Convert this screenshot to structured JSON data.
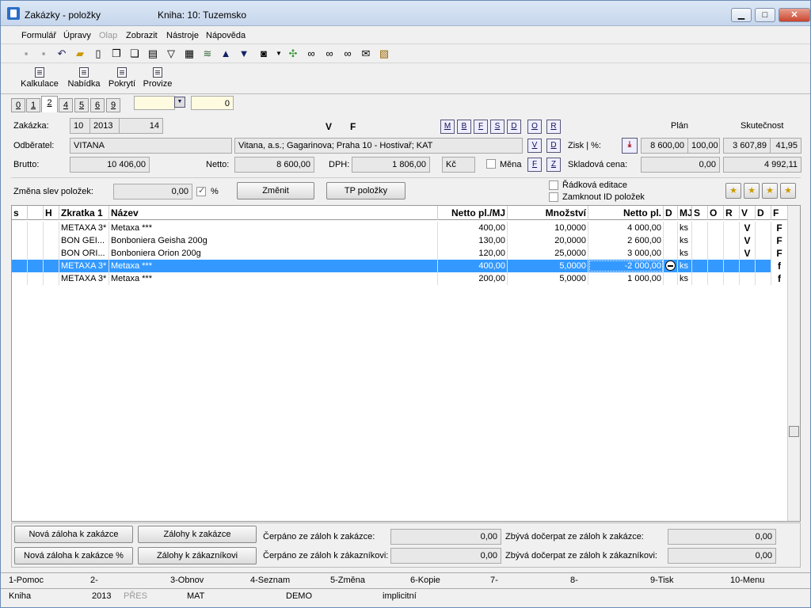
{
  "window": {
    "title": "Zakázky - položky",
    "subtitle": "Kniha: 10: Tuzemsko",
    "btn_min": "▁",
    "btn_max": "□",
    "btn_close": "✕"
  },
  "menu": [
    {
      "label": "Formulář",
      "disabled": false
    },
    {
      "label": "Úpravy",
      "disabled": false
    },
    {
      "label": "Olap",
      "disabled": true
    },
    {
      "label": "Zobrazit",
      "disabled": false
    },
    {
      "label": "Nástroje",
      "disabled": false
    },
    {
      "label": "Nápověda",
      "disabled": false
    }
  ],
  "toolbar_icons": [
    "save-icon",
    "save-as-icon",
    "undo-icon",
    "open-folder-icon",
    "new-doc-icon",
    "copy-icon",
    "paste-icon",
    "book-icon",
    "filter-icon",
    "report-icon",
    "stack-icon",
    "arrow-up-icon",
    "arrow-down-icon",
    "camera-icon",
    "dropdown-icon",
    "plant-icon",
    "binoculars-icon",
    "binoculars-down-icon",
    "binoculars-up-icon",
    "mail-icon",
    "notes-icon"
  ],
  "big_buttons": [
    "Kalkulace",
    "Nabídka",
    "Pokrytí",
    "Provize"
  ],
  "tabs": [
    "0",
    "1",
    "2",
    "4",
    "5",
    "6",
    "9"
  ],
  "tab_active": "2",
  "tab_extra_value": "0",
  "form": {
    "zakazka_label": "Zakázka:",
    "zakazka_book": "10",
    "zakazka_year": "2013",
    "zakazka_num": "14",
    "vf_v": "V",
    "vf_f": "F",
    "mbfsd": [
      "M",
      "B",
      "F",
      "S",
      "D"
    ],
    "ord_btns": [
      "O",
      "R",
      "V",
      "D",
      "F",
      "Z"
    ],
    "odberatel_label": "Odběratel:",
    "odberatel_code": "VITANA",
    "odberatel_full": "Vitana, a.s.; Gagarinova; Praha 10 - Hostivař; KAT",
    "brutto_label": "Brutto:",
    "brutto": "10 406,00",
    "netto_label": "Netto:",
    "netto": "8 600,00",
    "dph_label": "DPH:",
    "dph": "1 806,00",
    "mena_val": "Kč",
    "mena_label": "Měna",
    "plan_label": "Plán",
    "skutecnost_label": "Skutečnost",
    "zisk_label": "Zisk | %:",
    "zisk_plan": "8 600,00",
    "zisk_plan_pct": "100,00",
    "zisk_skut": "3 607,89",
    "zisk_skut_pct": "41,95",
    "skladova_label": "Skladová cena:",
    "skladova_plan": "0,00",
    "skladova_skut": "4 992,11",
    "zmena_label": "Změna slev položek:",
    "zmena_val": "0,00",
    "zmena_pct": "%",
    "zmenit_btn": "Změnit",
    "tp_btn": "TP položky",
    "radkova_label": "Řádková editace",
    "zamknout_label": "Zamknout ID položek"
  },
  "grid": {
    "columns": [
      "s",
      "",
      "H",
      "Zkratka 1",
      "Název",
      "Netto pl./MJ",
      "Množství",
      "Netto pl.",
      "D",
      "MJ",
      "S",
      "O",
      "R",
      "V",
      "D",
      "F"
    ],
    "rows": [
      {
        "zkratka": "METAXA 3*",
        "nazev": "Metaxa ***",
        "netto_mj": "400,00",
        "mnozstvi": "10,0000",
        "netto": "4 000,00",
        "d": "",
        "mj": "ks",
        "v": "V",
        "f": "F"
      },
      {
        "zkratka": "BON GEI...",
        "nazev": "Bonboniera Geisha 200g",
        "netto_mj": "130,00",
        "mnozstvi": "20,0000",
        "netto": "2 600,00",
        "d": "",
        "mj": "ks",
        "v": "V",
        "f": "F"
      },
      {
        "zkratka": "BON ORI...",
        "nazev": "Bonboniera Orion 200g",
        "netto_mj": "120,00",
        "mnozstvi": "25,0000",
        "netto": "3 000,00",
        "d": "",
        "mj": "ks",
        "v": "V",
        "f": "F"
      },
      {
        "zkratka": "METAXA 3*",
        "nazev": "Metaxa ***",
        "netto_mj": "400,00",
        "mnozstvi": "5,0000",
        "netto": "-2 000,00",
        "d": "minus",
        "mj": "ks",
        "v": "",
        "f": "f"
      },
      {
        "zkratka": "METAXA 3*",
        "nazev": "Metaxa ***",
        "netto_mj": "200,00",
        "mnozstvi": "5,0000",
        "netto": "1 000,00",
        "d": "",
        "mj": "ks",
        "v": "",
        "f": "f"
      }
    ],
    "selected_row": 3
  },
  "bottom": {
    "btn1": "Nová záloha k zakázce",
    "btn2": "Zálohy k zakázce",
    "btn3": "Nová záloha k zakázce %",
    "btn4": "Zálohy k zákazníkovi",
    "cerp1_label": "Čerpáno ze záloh k zakázce:",
    "cerp1": "0,00",
    "cerp2_label": "Čerpáno ze záloh k zákazníkovi:",
    "cerp2": "0,00",
    "zbyva1_label": "Zbývá dočerpat ze záloh k zakázce:",
    "zbyva1": "0,00",
    "zbyva2_label": "Zbývá dočerpat ze záloh k zákazníkovi:",
    "zbyva2": "0,00"
  },
  "fkeys": [
    "1-Pomoc",
    "2-",
    "3-Obnov",
    "4-Seznam",
    "5-Změna",
    "6-Kopie",
    "7-",
    "8-",
    "9-Tisk",
    "10-Menu"
  ],
  "statusbar": [
    "Kniha",
    "2013",
    "PŘES",
    "MAT",
    "DEMO",
    "implicitní"
  ]
}
